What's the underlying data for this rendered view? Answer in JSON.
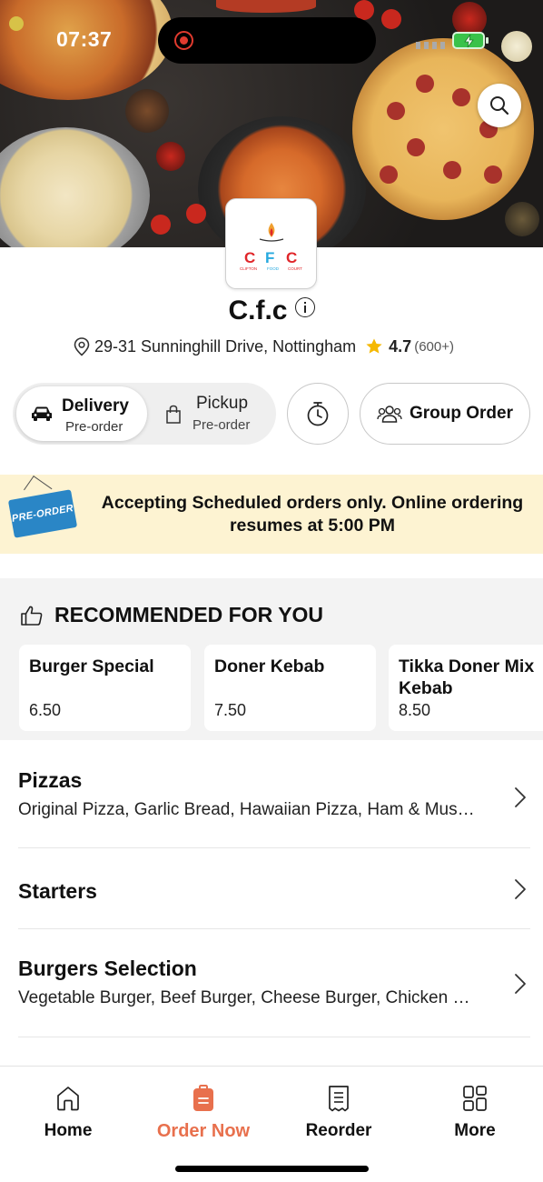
{
  "status_bar": {
    "time": "07:37"
  },
  "hero": {
    "search_icon": "search-icon"
  },
  "restaurant": {
    "logo_letters": [
      "C",
      "F",
      "C"
    ],
    "logo_subtext": [
      "CLIFTON",
      "FOOD",
      "COURT"
    ],
    "name": "C.f.c",
    "address": "29-31 Sunninghill Drive, Nottingham",
    "rating": "4.7",
    "rating_count": "(600+)"
  },
  "order_mode": {
    "delivery": {
      "label": "Delivery",
      "sub": "Pre-order",
      "selected": true
    },
    "pickup": {
      "label": "Pickup",
      "sub": "Pre-order",
      "selected": false
    },
    "group_order": "Group Order"
  },
  "banner": {
    "tag": "PRE-ORDER",
    "text": "Accepting Scheduled orders only. Online ordering resumes at 5:00 PM"
  },
  "recommended": {
    "title": "RECOMMENDED FOR YOU",
    "items": [
      {
        "name": "Burger Special",
        "price": "6.50"
      },
      {
        "name": "Doner Kebab",
        "price": "7.50"
      },
      {
        "name": "Tikka Doner Mix Kebab",
        "price": "8.50"
      }
    ]
  },
  "categories": [
    {
      "title": "Pizzas",
      "subtitle": "Original Pizza, Garlic Bread, Hawaiian Pizza, Ham & Mushroom Pizza"
    },
    {
      "title": "Starters",
      "subtitle": ""
    },
    {
      "title": "Burgers Selection",
      "subtitle": "Vegetable Burger, Beef Burger, Cheese Burger, Chicken Burger"
    }
  ],
  "bottom_nav": [
    {
      "label": "Home",
      "icon": "home-icon",
      "active": false
    },
    {
      "label": "Order Now",
      "icon": "order-bag-icon",
      "active": true
    },
    {
      "label": "Reorder",
      "icon": "receipt-icon",
      "active": false
    },
    {
      "label": "More",
      "icon": "grid-icon",
      "active": false
    }
  ],
  "colors": {
    "accent": "#e8704d",
    "banner_bg": "#fdf3d2",
    "star": "#f5b800",
    "logo_red": "#e0262a",
    "logo_blue": "#27a9df"
  }
}
